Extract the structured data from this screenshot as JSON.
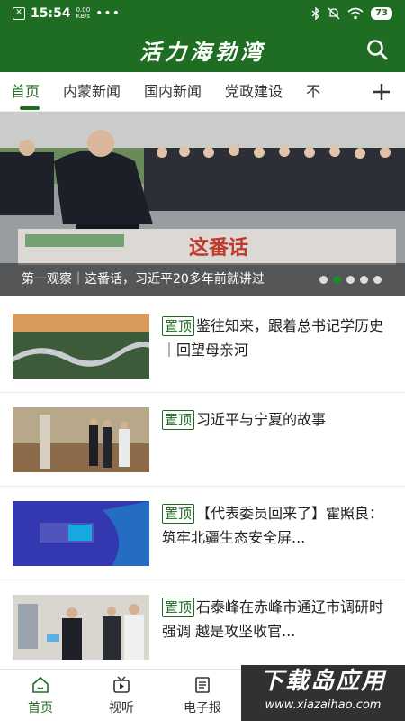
{
  "status_bar": {
    "time": "15:54",
    "net_speed": "0.00",
    "net_unit": "KB/s",
    "more": "•••",
    "battery": "73",
    "icons": [
      "bluetooth-icon",
      "mute-icon",
      "wifi-icon",
      "battery-icon"
    ]
  },
  "header": {
    "title": "活力海勃湾",
    "search_icon": "search-icon"
  },
  "tabs": [
    {
      "label": "首页"
    },
    {
      "label": "内蒙新闻"
    },
    {
      "label": "国内新闻"
    },
    {
      "label": "党政建设"
    },
    {
      "label": "不"
    }
  ],
  "banner": {
    "caption": "第一观察｜这番话，习近平20多年前就讲过",
    "dots_total": 5,
    "active_dot": 2
  },
  "news": [
    {
      "pin": "置顶",
      "title": "鉴往知来，跟着总书记学历史｜回望母亲河"
    },
    {
      "pin": "置顶",
      "title": "习近平与宁夏的故事"
    },
    {
      "pin": "置顶",
      "title": "【代表委员回来了】霍照良：筑牢北疆生态安全屏..."
    },
    {
      "pin": "置顶",
      "title": "石泰峰在赤峰市通辽市调研时强调 越是攻坚收官..."
    }
  ],
  "bottom_nav": [
    {
      "label": "首页",
      "icon": "home-icon"
    },
    {
      "label": "视听",
      "icon": "video-icon"
    },
    {
      "label": "电子报",
      "icon": "newspaper-icon"
    },
    {
      "label": "",
      "icon": ""
    },
    {
      "label": "",
      "icon": ""
    }
  ],
  "watermark": {
    "big": "下载岛应用",
    "small": "www.xiazaihao.com"
  },
  "colors": {
    "brand": "#1f6d22"
  }
}
